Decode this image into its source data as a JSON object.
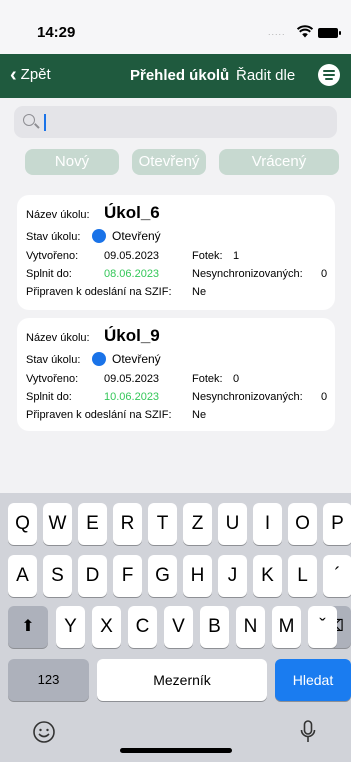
{
  "status_bar": {
    "time": "14:29",
    "signal": "....."
  },
  "navbar": {
    "back_label": "Zpět",
    "title": "Přehled úkolů",
    "sort_label": "Řadit dle"
  },
  "search": {
    "placeholder": "",
    "value": ""
  },
  "filters": [
    {
      "label": "Nový"
    },
    {
      "label": "Otevřený"
    },
    {
      "label": "Vrácený"
    }
  ],
  "tasks": [
    {
      "name_label": "Název úkolu:",
      "name": "Úkol_6",
      "state_label": "Stav úkolu:",
      "state": "Otevřený",
      "created_label": "Vytvořeno:",
      "created": "09.05.2023",
      "photos_label": "Fotek:",
      "photos": "1",
      "due_label": "Splnit do:",
      "due": "08.06.2023",
      "unsynced_label": "Nesynchronizovaných:",
      "unsynced": "0",
      "ready_label": "Připraven k odeslání na SZIF:",
      "ready": "Ne"
    },
    {
      "name_label": "Název úkolu:",
      "name": "Úkol_9",
      "state_label": "Stav úkolu:",
      "state": "Otevřený",
      "created_label": "Vytvořeno:",
      "created": "09.05.2023",
      "photos_label": "Fotek:",
      "photos": "0",
      "due_label": "Splnit do:",
      "due": "10.06.2023",
      "unsynced_label": "Nesynchronizovaných:",
      "unsynced": "0",
      "ready_label": "Připraven k odeslání na SZIF:",
      "ready": "Ne"
    }
  ],
  "keyboard": {
    "row1": [
      "Q",
      "W",
      "E",
      "R",
      "T",
      "Z",
      "U",
      "I",
      "O",
      "P"
    ],
    "row2": [
      "A",
      "S",
      "D",
      "F",
      "G",
      "H",
      "J",
      "K",
      "L",
      "´"
    ],
    "row3": [
      "Y",
      "X",
      "C",
      "V",
      "B",
      "N",
      "M",
      "ˇ"
    ],
    "shift": "⬆",
    "backspace": "⌫",
    "numbers": "123",
    "space": "Mezerník",
    "search": "Hledat",
    "emoji": "☺",
    "mic": "🎤"
  },
  "colors": {
    "navbar": "#1f5a3e",
    "accent": "#1a73e8",
    "due_date": "#34c759",
    "search_key": "#1a7cf0"
  }
}
